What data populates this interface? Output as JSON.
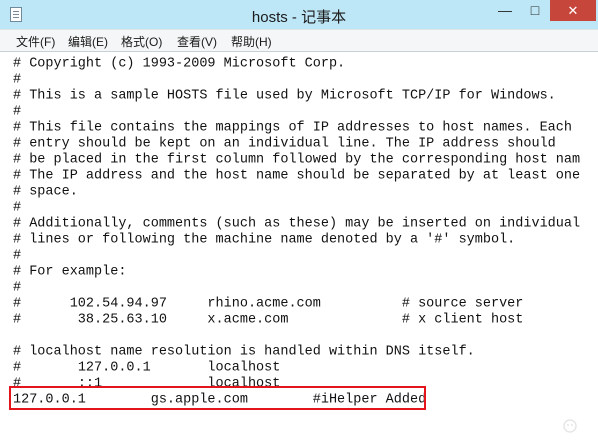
{
  "window": {
    "title": "hosts - 记事本",
    "minimize_glyph": "—",
    "maximize_glyph": "□",
    "close_glyph": "✕"
  },
  "menu": [
    {
      "label": "文件(F)"
    },
    {
      "label": "编辑(E)"
    },
    {
      "label": "格式(O)"
    },
    {
      "label": "查看(V)"
    },
    {
      "label": "帮助(H)"
    }
  ],
  "editor": {
    "lines": [
      "# Copyright (c) 1993-2009 Microsoft Corp.",
      "#",
      "# This is a sample HOSTS file used by Microsoft TCP/IP for Windows.",
      "#",
      "# This file contains the mappings of IP addresses to host names. Each",
      "# entry should be kept on an individual line. The IP address should",
      "# be placed in the first column followed by the corresponding host nam",
      "# The IP address and the host name should be separated by at least one",
      "# space.",
      "#",
      "# Additionally, comments (such as these) may be inserted on individual",
      "# lines or following the machine name denoted by a '#' symbol.",
      "#",
      "# For example:",
      "#",
      "#      102.54.94.97     rhino.acme.com          # source server",
      "#       38.25.63.10     x.acme.com              # x client host",
      "",
      "# localhost name resolution is handled within DNS itself.",
      "#\t127.0.0.1       localhost",
      "#\t::1             localhost",
      "127.0.0.1        gs.apple.com        #iHelper Added"
    ]
  },
  "colors": {
    "title_bar": "#bde6f6",
    "close_button": "#c7463c",
    "highlight_border": "#e4141c"
  }
}
